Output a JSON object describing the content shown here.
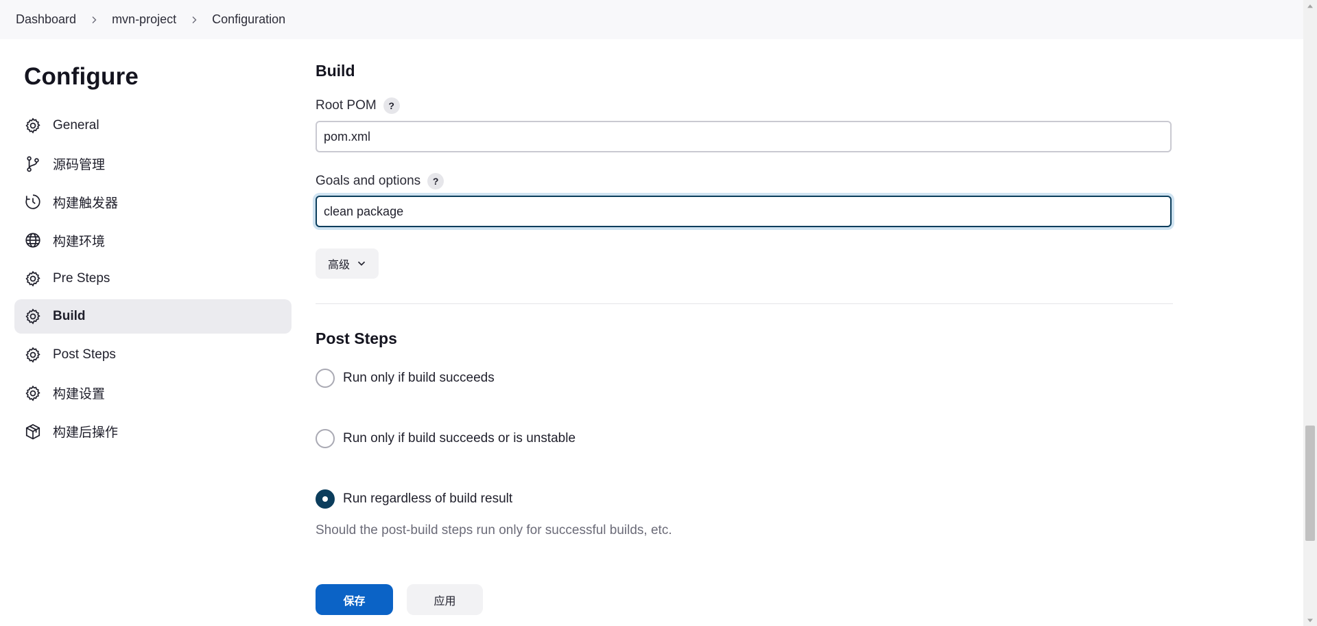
{
  "breadcrumb": {
    "items": [
      "Dashboard",
      "mvn-project",
      "Configuration"
    ]
  },
  "sidebar": {
    "title": "Configure",
    "items": [
      {
        "label": "General",
        "icon": "gear-icon",
        "active": false
      },
      {
        "label": "源码管理",
        "icon": "git-branch-icon",
        "active": false
      },
      {
        "label": "构建触发器",
        "icon": "clock-icon",
        "active": false
      },
      {
        "label": "构建环境",
        "icon": "globe-icon",
        "active": false
      },
      {
        "label": "Pre Steps",
        "icon": "gear-icon",
        "active": false
      },
      {
        "label": "Build",
        "icon": "gear-icon",
        "active": true
      },
      {
        "label": "Post Steps",
        "icon": "gear-icon",
        "active": false
      },
      {
        "label": "构建设置",
        "icon": "gear-icon",
        "active": false
      },
      {
        "label": "构建后操作",
        "icon": "package-icon",
        "active": false
      }
    ]
  },
  "build": {
    "title": "Build",
    "root_pom": {
      "label": "Root POM",
      "help": "?",
      "value": "pom.xml"
    },
    "goals": {
      "label": "Goals and options",
      "help": "?",
      "value": "clean package"
    },
    "advanced_label": "高级"
  },
  "post_steps": {
    "title": "Post Steps",
    "options": [
      {
        "label": "Run only if build succeeds",
        "checked": false
      },
      {
        "label": "Run only if build succeeds or is unstable",
        "checked": false
      },
      {
        "label": "Run regardless of build result",
        "checked": true
      }
    ],
    "hint": "Should the post-build steps run only for successful builds, etc."
  },
  "actions": {
    "save_label": "保存",
    "apply_label": "应用"
  },
  "colors": {
    "primary": "#0b63c6",
    "focus_border": "#0b3d5c",
    "active_nav": "#ebebef"
  }
}
